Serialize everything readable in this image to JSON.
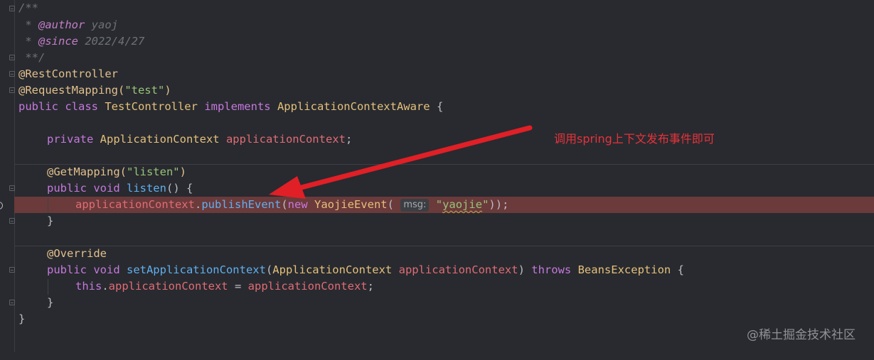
{
  "editor": {
    "language": "java",
    "lines": {
      "l1": "/**",
      "l2_star": " * ",
      "l2_tag": "@author",
      "l2_val": " yaoj",
      "l3_star": " * ",
      "l3_tag": "@since",
      "l3_val": " 2022/4/27",
      "l4": " **/",
      "l5": "@RestController",
      "l6_ann": "@RequestMapping(",
      "l6_str": "\"test\"",
      "l6_end": ")",
      "l7_kw1": "public class ",
      "l7_cls": "TestController ",
      "l7_kw2": "implements ",
      "l7_iface": "ApplicationContextAware ",
      "l7_brace": "{",
      "l9_kw": "private ",
      "l9_type": "ApplicationContext ",
      "l9_field": "applicationContext",
      "l9_semi": ";",
      "l11_ann": "@GetMapping(",
      "l11_str": "\"listen\"",
      "l11_end": ")",
      "l12_kw": "public void ",
      "l12_fn": "listen",
      "l12_rest": "() {",
      "l13_field": "applicationContext",
      "l13_dot": ".",
      "l13_fn": "publishEvent",
      "l13_paren": "(",
      "l13_kw": "new ",
      "l13_cls": "YaojieEvent",
      "l13_paren2": "( ",
      "l13_hint": "msg:",
      "l13_str_q1": " \"",
      "l13_str_word": "yaojie",
      "l13_str_q2": "\"",
      "l13_end": "));",
      "l14": "}",
      "l16": "@Override",
      "l17_kw": "public void ",
      "l17_fn": "setApplicationContext",
      "l17_p1": "(",
      "l17_type": "ApplicationContext ",
      "l17_param": "applicationContext",
      "l17_p2": ") ",
      "l17_throws": "throws ",
      "l17_exc": "BeansException ",
      "l17_brace": "{",
      "l18_this": "this",
      "l18_dot": ".",
      "l18_field": "applicationContext",
      "l18_eq": " = ",
      "l18_param": "applicationContext",
      "l18_semi": ";",
      "l19": "}",
      "l20": "}"
    }
  },
  "annotation": {
    "text": "调用spring上下文发布事件即可",
    "color": "#e8323b"
  },
  "watermark": "@稀土掘金技术社区",
  "colors": {
    "background": "#282a2f",
    "highlight_line": "#6b3a3b",
    "arrow": "#e01f26"
  }
}
